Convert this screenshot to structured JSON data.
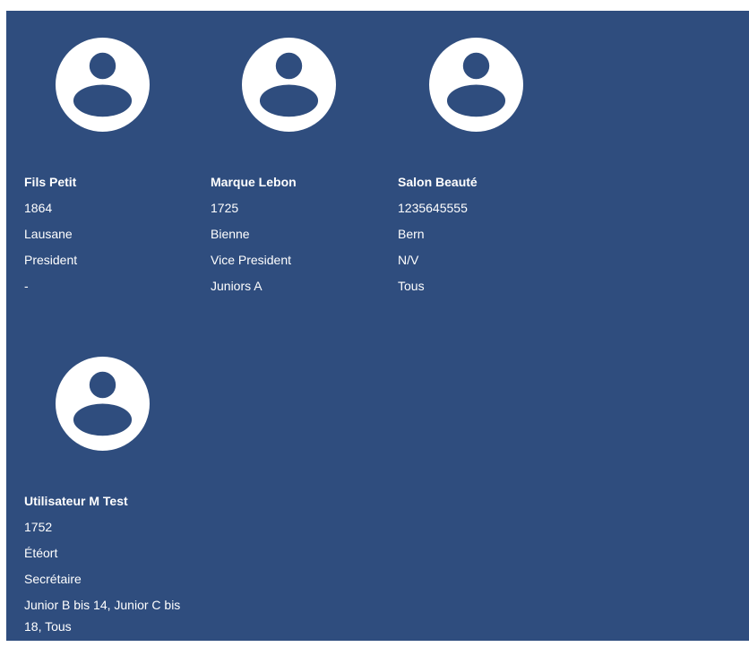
{
  "members": [
    {
      "name": "Fils Petit",
      "number": "1864",
      "city": "Lausane",
      "role": "President",
      "teams": "-"
    },
    {
      "name": "Marque Lebon",
      "number": "1725",
      "city": "Bienne",
      "role": "Vice President",
      "teams": "Juniors A"
    },
    {
      "name": "Salon Beauté",
      "number": "1235645555",
      "city": "Bern",
      "role": "N/V",
      "teams": "Tous"
    },
    {
      "name": "Utilisateur M Test",
      "number": "1752",
      "city": "Étéort",
      "role": "Secrétaire",
      "teams": "Junior B bis 14, Junior C bis 18, Tous"
    }
  ],
  "colors": {
    "panel_background": "#2f4d7e",
    "text": "#ffffff",
    "avatar_circle": "#ffffff",
    "avatar_figure": "#2f4d7e"
  },
  "icons": {
    "avatar": "account-circle-icon"
  }
}
